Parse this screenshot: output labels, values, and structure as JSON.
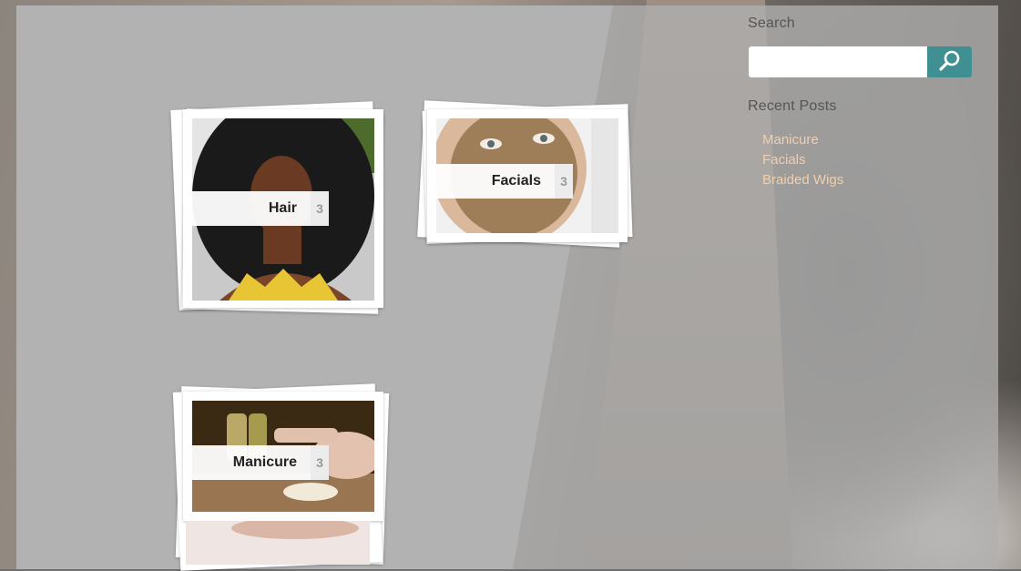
{
  "colors": {
    "accent": "#3f8f93",
    "link": "#f2cfae",
    "overlay": "#b2b2b2"
  },
  "categories": [
    {
      "name": "Hair",
      "count": "3",
      "image": "woman-curly-hair-photo"
    },
    {
      "name": "Facials",
      "count": "3",
      "image": "face-scrub-mask-photo"
    },
    {
      "name": "Manicure",
      "count": "3",
      "image": "manicure-oils-photo"
    }
  ],
  "sidebar": {
    "search_heading": "Search",
    "search_value": "",
    "search_icon": "search-icon",
    "recent_heading": "Recent Posts",
    "recent_posts": [
      "Manicure",
      "Facials",
      "Braided Wigs"
    ]
  }
}
